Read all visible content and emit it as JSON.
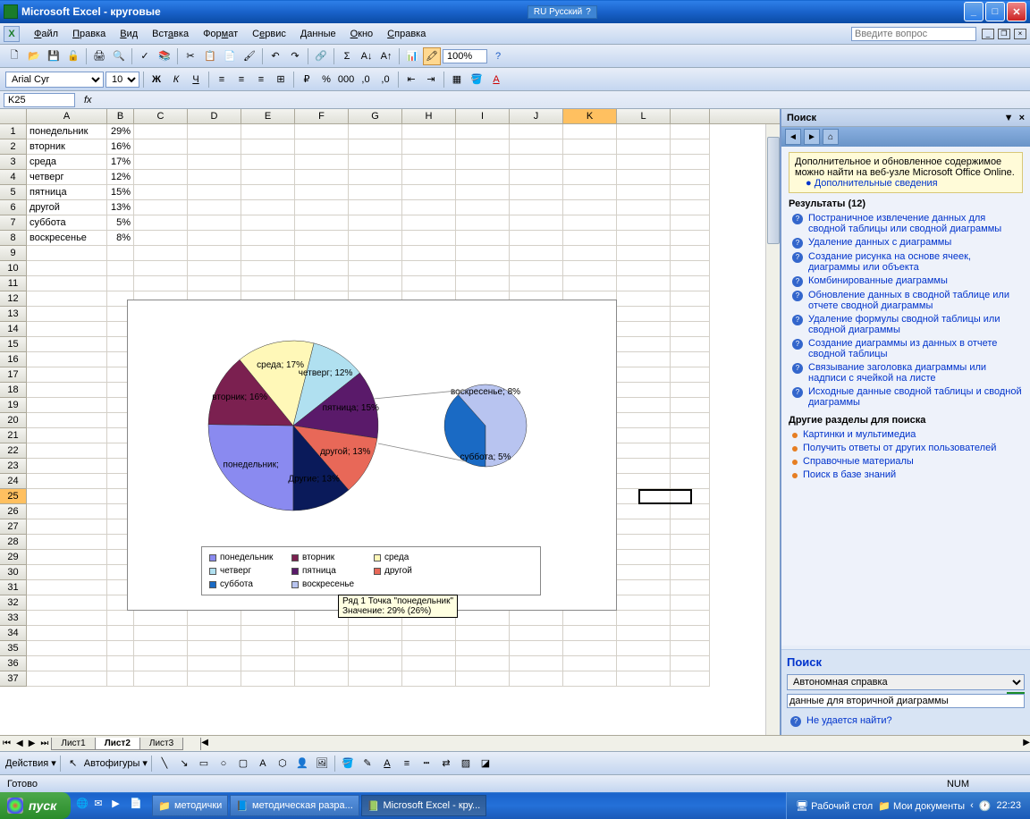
{
  "title": "Microsoft Excel - круговые",
  "language": "RU Русский",
  "menu": [
    "Файл",
    "Правка",
    "Вид",
    "Вставка",
    "Формат",
    "Сервис",
    "Данные",
    "Окно",
    "Справка"
  ],
  "qbox_placeholder": "Введите вопрос",
  "font": "Arial Cyr",
  "fontsize": "10",
  "zoom": "100%",
  "namebox": "K25",
  "cols": [
    "A",
    "B",
    "C",
    "D",
    "E",
    "F",
    "G",
    "H",
    "I",
    "J",
    "K",
    "L"
  ],
  "data_rows": [
    {
      "a": "понедельник",
      "b": "29%"
    },
    {
      "a": "вторник",
      "b": "16%"
    },
    {
      "a": "среда",
      "b": "17%"
    },
    {
      "a": "четверг",
      "b": "12%"
    },
    {
      "a": "пятница",
      "b": "15%"
    },
    {
      "a": "другой",
      "b": "13%"
    },
    {
      "a": "суббота",
      "b": "5%"
    },
    {
      "a": "воскресенье",
      "b": "8%"
    }
  ],
  "tooltip_line1": "Ряд 1 Точка \"понедельник\"",
  "tooltip_line2": "Значение: 29% (26%)",
  "sheets": [
    "Лист1",
    "Лист2",
    "Лист3"
  ],
  "active_sheet": "Лист2",
  "taskpane": {
    "title": "Поиск",
    "info": "Дополнительное и обновленное содержимое можно найти на веб-узле Microsoft Office Online.",
    "info_link": "Дополнительные сведения",
    "results_label": "Результаты (12)",
    "items": [
      "Постраничное извлечение данных для сводной таблицы или сводной диаграммы",
      "Удаление данных с диаграммы",
      "Создание рисунка на основе ячеек, диаграммы или объекта",
      "Комбинированные диаграммы",
      "Обновление данных в сводной таблице или отчете сводной диаграммы",
      "Удаление формулы сводной таблицы или сводной диаграммы",
      "Создание диаграммы из данных в отчете сводной таблицы",
      "Связывание заголовка диаграммы или надписи с ячейкой на листе",
      "Исходные данные сводной таблицы и сводной диаграммы"
    ],
    "other_section": "Другие разделы для поиска",
    "other_items": [
      "Картинки и мультимедиа",
      "Получить ответы от других пользователей",
      "Справочные материалы",
      "Поиск в базе знаний"
    ],
    "search_label": "Поиск",
    "search_source": "Автономная справка",
    "search_query": "данные для вторичной диаграммы",
    "cant_find": "Не удается найти?"
  },
  "drawbar": {
    "actions": "Действия",
    "autoshapes": "Автофигуры"
  },
  "status": "Готово",
  "status_num": "NUM",
  "taskbar": {
    "start": "пуск",
    "items": [
      "методички",
      "методическая разра...",
      "Microsoft Excel - кру..."
    ],
    "tray": [
      "Рабочий стол",
      "Мои документы"
    ],
    "time": "22:23"
  },
  "chart_data": {
    "type": "pie",
    "title": "",
    "main_slices": [
      {
        "name": "понедельник",
        "value": 29,
        "shown_pct": 26,
        "color": "#8a8af0",
        "label": "понедельник;"
      },
      {
        "name": "вторник",
        "value": 16,
        "color": "#7b2050",
        "label": "вторник; 16%"
      },
      {
        "name": "среда",
        "value": 17,
        "color": "#fff8b8",
        "label": "среда; 17%"
      },
      {
        "name": "четверг",
        "value": 12,
        "color": "#b0e0f0",
        "label": "четверг; 12%"
      },
      {
        "name": "пятница",
        "value": 15,
        "color": "#5a1a6a",
        "label": "пятница; 15%"
      },
      {
        "name": "другой",
        "value": 13,
        "color": "#e86858",
        "label": "другой; 13%"
      },
      {
        "name": "Другие",
        "value": 13,
        "color": "#0a1a5a",
        "label": "Другие; 13%"
      }
    ],
    "secondary_slices": [
      {
        "name": "суббота",
        "value": 5,
        "color": "#1a6ac4",
        "label": "суббота; 5%"
      },
      {
        "name": "воскресенье",
        "value": 8,
        "color": "#b8c4f0",
        "label": "воскресенье; 8%"
      }
    ]
  }
}
